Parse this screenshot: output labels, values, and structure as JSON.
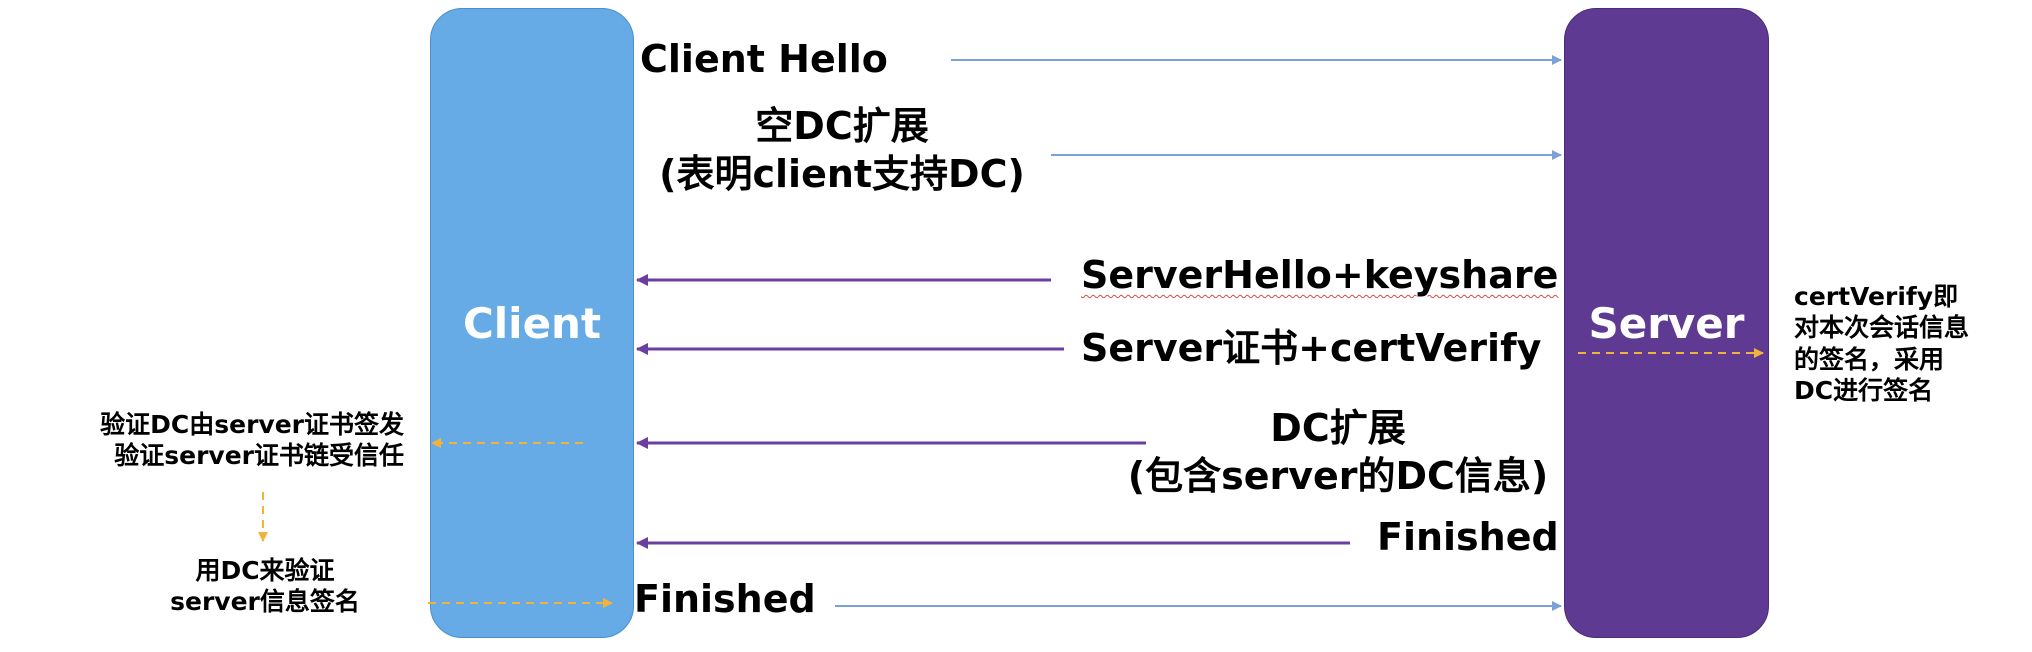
{
  "entities": {
    "client": "Client",
    "server": "Server"
  },
  "messages": {
    "client_hello": "Client Hello",
    "empty_dc_line1": "空DC扩展",
    "empty_dc_line2": "(表明client支持DC)",
    "server_hello": "ServerHello+keyshare",
    "server_cert": "Server证书+certVerify",
    "dc_ext_line1": "DC扩展",
    "dc_ext_line2": "(包含server的DC信息)",
    "server_finished": "Finished",
    "client_finished": "Finished"
  },
  "notes": {
    "server_note": [
      "certVerify即",
      "对本次会话信息",
      "的签名，采用",
      "DC进行签名"
    ],
    "client_verify": [
      "验证DC由server证书签发",
      "验证server证书链受信任"
    ],
    "client_use_dc": [
      "用DC来验证",
      "server信息签名"
    ]
  },
  "colors": {
    "client_box": "#66ABE6",
    "server_box": "#5E3A92",
    "client_arrow": "#7AA2D6",
    "server_arrow": "#6B3FA0",
    "note_arrow": "#F2B33D"
  }
}
